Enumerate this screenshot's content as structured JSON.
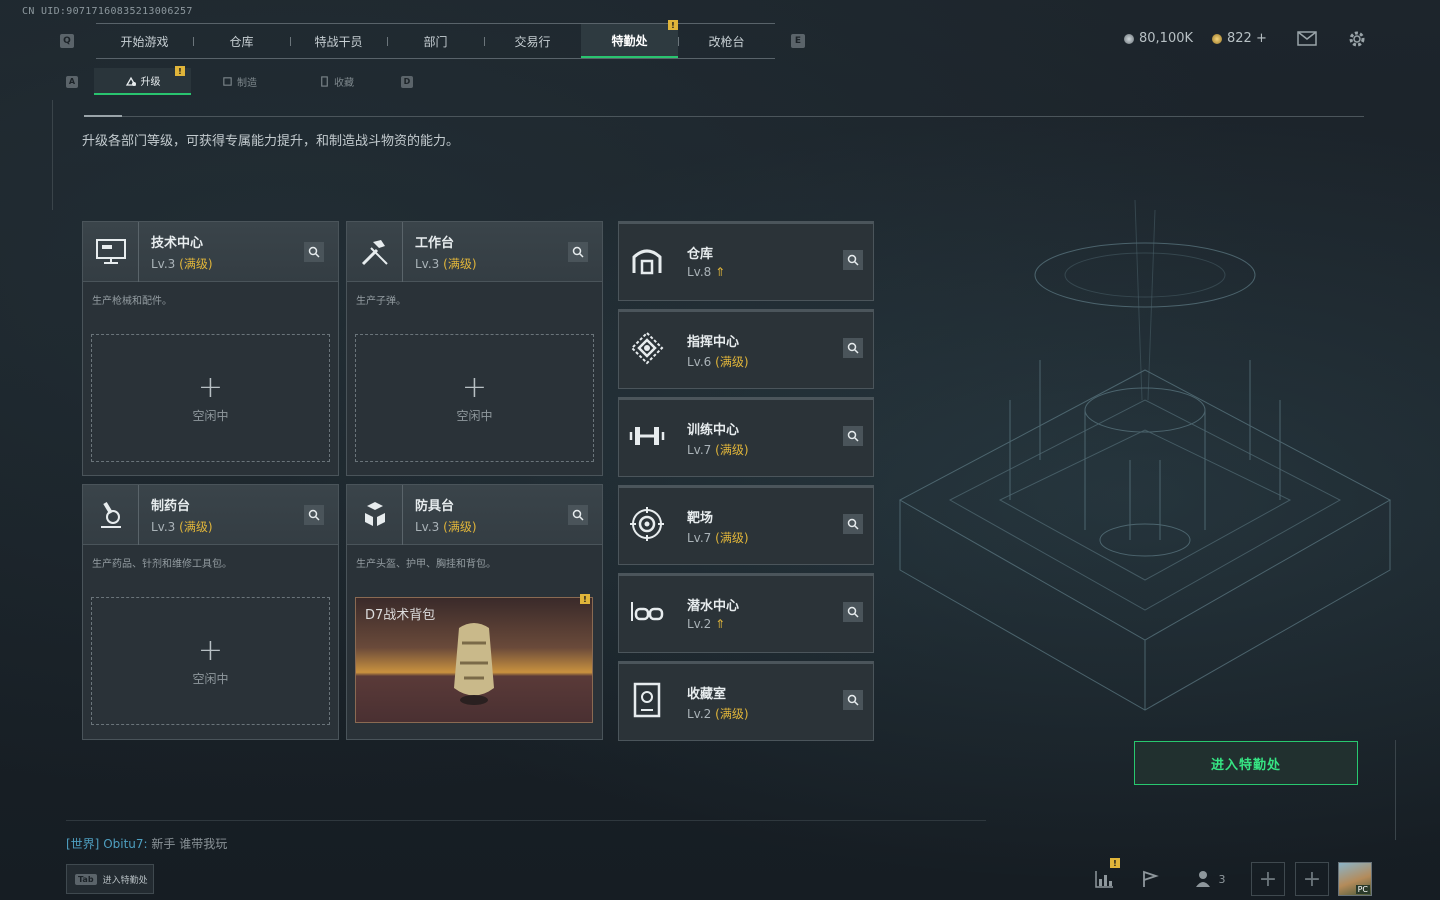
{
  "uid": "CN UID:90717160835213006257",
  "topnav": {
    "left_key": "Q",
    "right_key": "E",
    "tabs": [
      {
        "label": "开始游戏"
      },
      {
        "label": "仓库"
      },
      {
        "label": "特战干员"
      },
      {
        "label": "部门"
      },
      {
        "label": "交易行"
      },
      {
        "label": "特勤处",
        "active": true,
        "alert": "!"
      },
      {
        "label": "改枪台"
      }
    ]
  },
  "subnav": {
    "left_key": "A",
    "right_key": "D",
    "tabs": [
      {
        "label": "升级",
        "active": true,
        "alert": "!"
      },
      {
        "label": "制造"
      },
      {
        "label": "收藏"
      }
    ]
  },
  "resources": {
    "silver": "80,100K",
    "gold": "822 +"
  },
  "description": "升级各部门等级，可获得专属能力提升，和制造战斗物资的能力。",
  "stations": [
    {
      "name": "技术中心",
      "level": "Lv.3",
      "max": "(满级)",
      "sub": "生产枪械和配件。",
      "slot": "空闲中",
      "icon": "monitor-icon"
    },
    {
      "name": "工作台",
      "level": "Lv.3",
      "max": "(满级)",
      "sub": "生产子弹。",
      "slot": "空闲中",
      "icon": "tools-icon"
    },
    {
      "name": "制药台",
      "level": "Lv.3",
      "max": "(满级)",
      "sub": "生产药品、针剂和维修工具包。",
      "slot": "空闲中",
      "icon": "microscope-icon"
    },
    {
      "name": "防具台",
      "level": "Lv.3",
      "max": "(满级)",
      "sub": "生产头盔、护甲、胸挂和背包。",
      "item": "D7战术背包",
      "item_alert": "!",
      "icon": "armor-blocks-icon"
    }
  ],
  "departments": [
    {
      "name": "仓库",
      "level": "Lv.8",
      "max": "",
      "upgradable": true,
      "icon": "warehouse-icon"
    },
    {
      "name": "指挥中心",
      "level": "Lv.6",
      "max": "(满级)",
      "icon": "command-icon"
    },
    {
      "name": "训练中心",
      "level": "Lv.7",
      "max": "(满级)",
      "icon": "dumbbell-icon"
    },
    {
      "name": "靶场",
      "level": "Lv.7",
      "max": "(满级)",
      "icon": "target-icon"
    },
    {
      "name": "潜水中心",
      "level": "Lv.2",
      "max": "",
      "upgradable": true,
      "icon": "goggles-icon"
    },
    {
      "name": "收藏室",
      "level": "Lv.2",
      "max": "(满级)",
      "icon": "collection-icon"
    }
  ],
  "enter_button": "进入特勤处",
  "chat": {
    "channel": "[世界]",
    "user": "Obitu7:",
    "message": "新手 谁带我玩"
  },
  "tab_hint": {
    "key": "Tab",
    "label": "进入特勤处"
  },
  "bottom": {
    "stats_alert": "!",
    "friends_count": "3",
    "avatar_badge": "PC"
  },
  "colors": {
    "accent_green": "#29c46f",
    "max_gold": "#e0b53a"
  }
}
